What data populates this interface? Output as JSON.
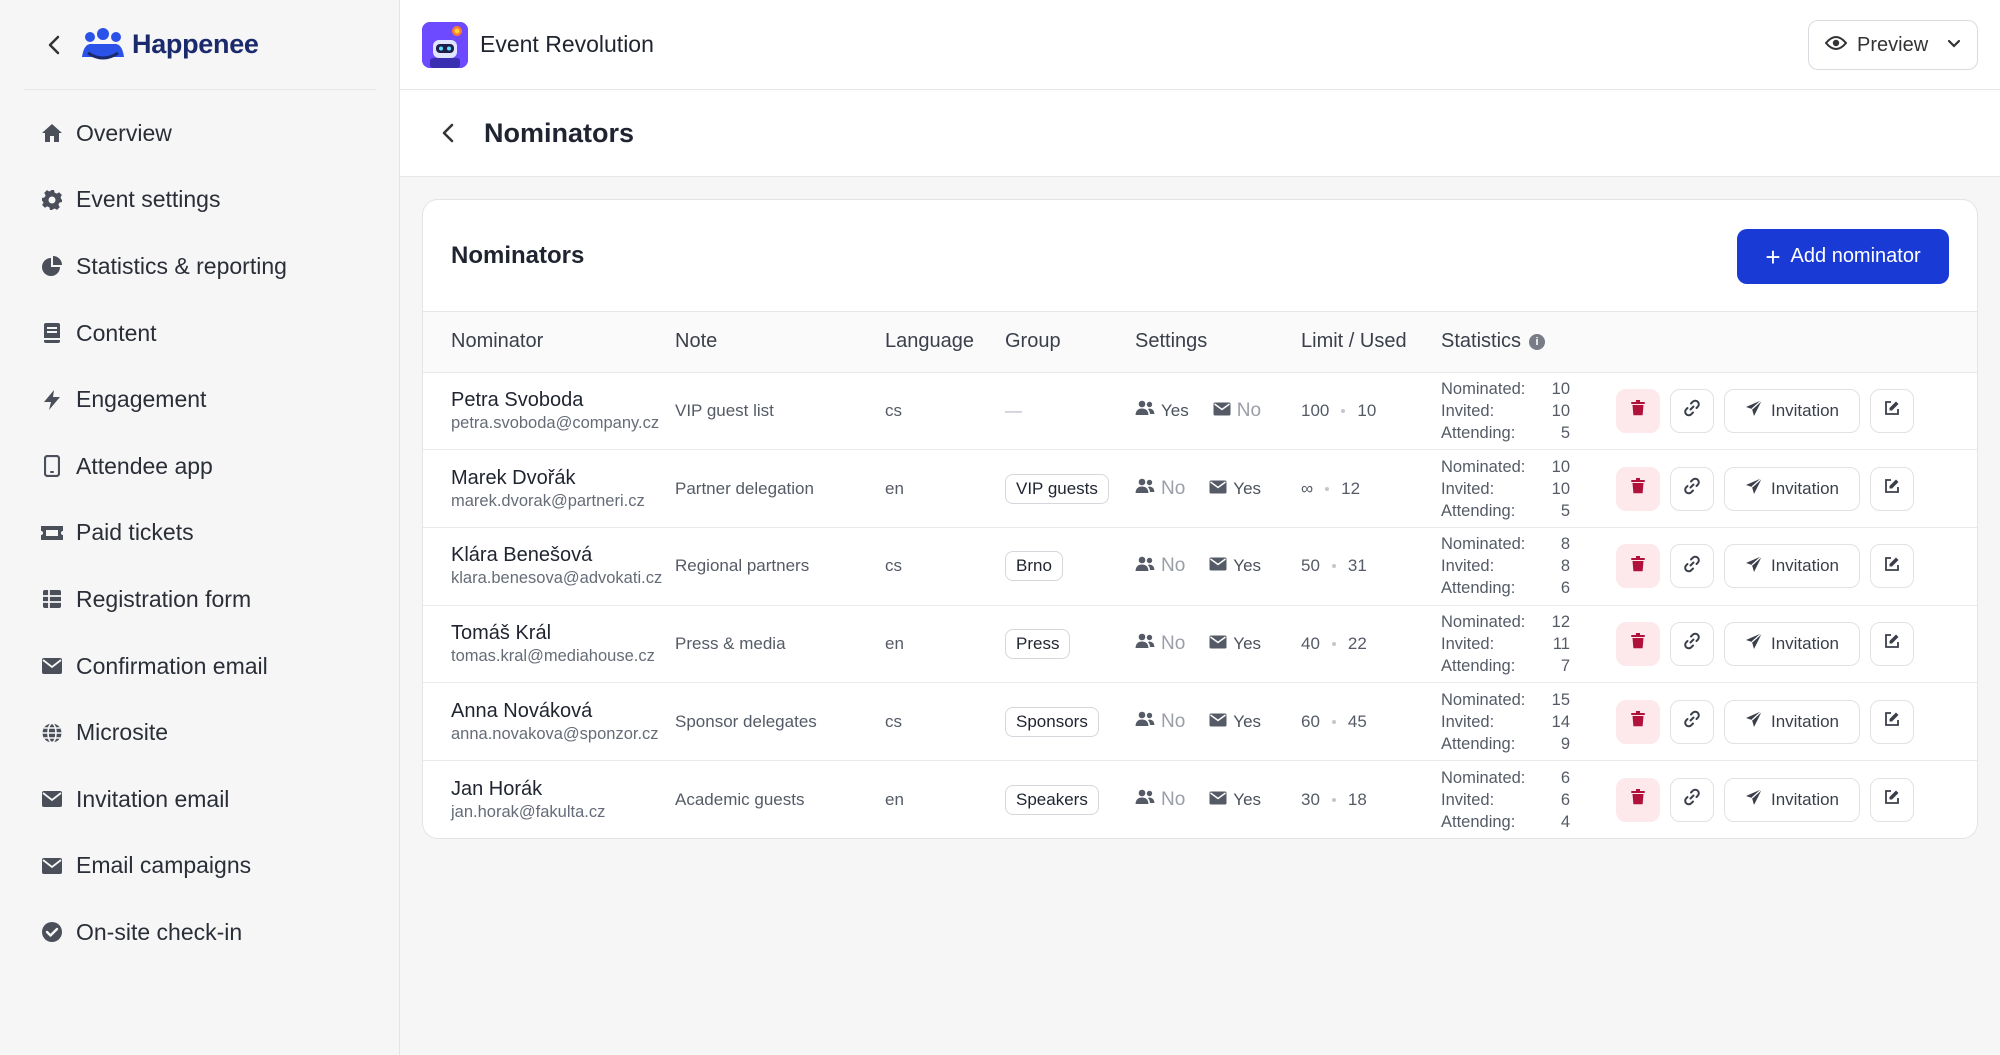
{
  "brand": {
    "name": "Happenee"
  },
  "sidebar": {
    "items": [
      {
        "label": "Overview",
        "icon": "home-icon"
      },
      {
        "label": "Event settings",
        "icon": "gear-icon"
      },
      {
        "label": "Statistics & reporting",
        "icon": "pie-chart-icon"
      },
      {
        "label": "Content",
        "icon": "book-icon"
      },
      {
        "label": "Engagement",
        "icon": "bolt-icon"
      },
      {
        "label": "Attendee app",
        "icon": "mobile-icon"
      },
      {
        "label": "Paid tickets",
        "icon": "ticket-icon"
      },
      {
        "label": "Registration form",
        "icon": "table-icon"
      },
      {
        "label": "Confirmation email",
        "icon": "envelope-icon"
      },
      {
        "label": "Microsite",
        "icon": "globe-icon"
      },
      {
        "label": "Invitation email",
        "icon": "envelope-icon"
      },
      {
        "label": "Email campaigns",
        "icon": "envelope-icon"
      },
      {
        "label": "On-site check-in",
        "icon": "check-circle-icon"
      }
    ]
  },
  "header": {
    "event_name": "Event Revolution",
    "preview_label": "Preview"
  },
  "page": {
    "title": "Nominators"
  },
  "card": {
    "title": "Nominators",
    "add_label": "Add nominator"
  },
  "table": {
    "columns": [
      "Nominator",
      "Note",
      "Language",
      "Group",
      "Settings",
      "Limit / Used",
      "Statistics"
    ],
    "stat_labels": {
      "nominated": "Nominated:",
      "invited": "Invited:",
      "attending": "Attending:"
    },
    "invitation_label": "Invitation",
    "rows": [
      {
        "name": "Petra Svoboda",
        "email": "petra.svoboda@company.cz",
        "note": "VIP guest list",
        "lang": "cs",
        "group": "",
        "plus_one": "Yes",
        "email_setting": "No",
        "limit": "100",
        "used": "10",
        "nominated": "10",
        "invited": "10",
        "attending": "5"
      },
      {
        "name": "Marek Dvořák",
        "email": "marek.dvorak@partneri.cz",
        "note": "Partner delegation",
        "lang": "en",
        "group": "VIP guests",
        "plus_one": "No",
        "email_setting": "Yes",
        "limit": "∞",
        "used": "12",
        "nominated": "10",
        "invited": "10",
        "attending": "5"
      },
      {
        "name": "Klára Benešová",
        "email": "klara.benesova@advokati.cz",
        "note": "Regional partners",
        "lang": "cs",
        "group": "Brno",
        "plus_one": "No",
        "email_setting": "Yes",
        "limit": "50",
        "used": "31",
        "nominated": "8",
        "invited": "8",
        "attending": "6"
      },
      {
        "name": "Tomáš Král",
        "email": "tomas.kral@mediahouse.cz",
        "note": "Press & media",
        "lang": "en",
        "group": "Press",
        "plus_one": "No",
        "email_setting": "Yes",
        "limit": "40",
        "used": "22",
        "nominated": "12",
        "invited": "11",
        "attending": "7"
      },
      {
        "name": "Anna Nováková",
        "email": "anna.novakova@sponzor.cz",
        "note": "Sponsor delegates",
        "lang": "cs",
        "group": "Sponsors",
        "plus_one": "No",
        "email_setting": "Yes",
        "limit": "60",
        "used": "45",
        "nominated": "15",
        "invited": "14",
        "attending": "9"
      },
      {
        "name": "Jan Horák",
        "email": "jan.horak@fakulta.cz",
        "note": "Academic guests",
        "lang": "en",
        "group": "Speakers",
        "plus_one": "No",
        "email_setting": "Yes",
        "limit": "30",
        "used": "18",
        "nominated": "6",
        "invited": "6",
        "attending": "4"
      }
    ]
  },
  "colors": {
    "accent": "#1a3ad6",
    "brand": "#1a2a6c",
    "danger_bg": "#fde8ec",
    "danger": "#b0123c"
  }
}
